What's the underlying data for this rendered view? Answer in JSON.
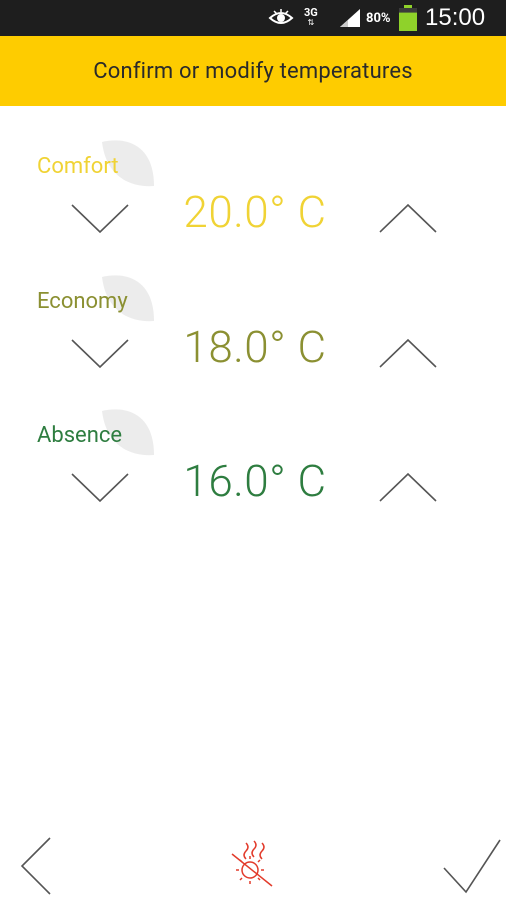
{
  "status_bar": {
    "network": "3G",
    "battery_percent": "80%",
    "battery_level": 0.8,
    "time": "15:00",
    "icons": [
      "eye-icon",
      "network-3g-icon",
      "signal-icon",
      "battery-icon"
    ]
  },
  "header": {
    "title": "Confirm or modify temperatures"
  },
  "colors": {
    "header_bg": "#fecc00",
    "comfort": "#f0d335",
    "economy": "#8b9032",
    "absence": "#2e7d40",
    "chevron": "#555555",
    "eco_icon": "#e23b2b"
  },
  "temperatures": [
    {
      "label": "Comfort",
      "value": "20.0° C"
    },
    {
      "label": "Economy",
      "value": "18.0° C"
    },
    {
      "label": "Absence",
      "value": "16.0° C"
    }
  ],
  "bottom_bar": {
    "icons": [
      "back-chevron-icon",
      "sun-heat-off-icon",
      "checkmark-icon"
    ]
  }
}
